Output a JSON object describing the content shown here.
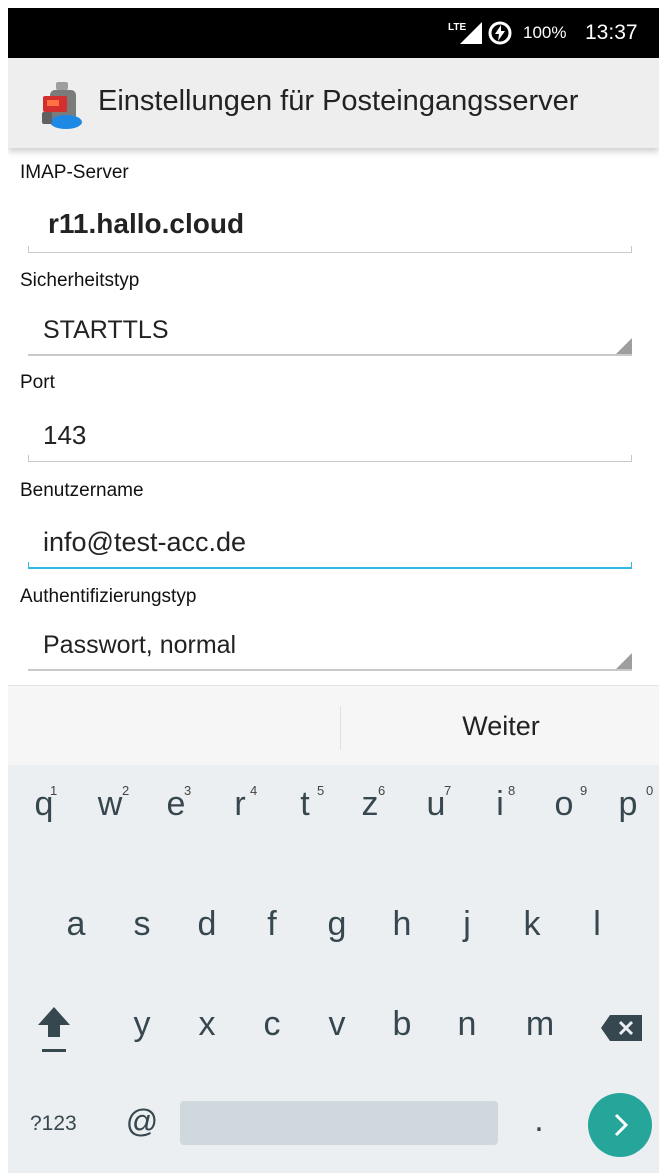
{
  "status_bar": {
    "network": "LTE",
    "battery": "100%",
    "time": "13:37",
    "icons": [
      "lte-signal-icon",
      "data-saver-icon"
    ]
  },
  "app_bar": {
    "title": "Einstellungen für Posteingangsserver",
    "icon": "app-logo-icon"
  },
  "form": {
    "imap_server": {
      "label": "IMAP-Server",
      "value": "r11.hallo.cloud"
    },
    "security": {
      "label": "Sicherheitstyp",
      "value": "STARTTLS"
    },
    "port": {
      "label": "Port",
      "value": "143"
    },
    "username": {
      "label": "Benutzername",
      "value": "info@test-acc.de"
    },
    "auth": {
      "label": "Authentifizierungstyp",
      "value": "Passwort, normal"
    }
  },
  "buttons": {
    "next": "Weiter"
  },
  "keyboard": {
    "row1": [
      "q",
      "w",
      "e",
      "r",
      "t",
      "z",
      "u",
      "i",
      "o",
      "p"
    ],
    "row1_hints": [
      "1",
      "2",
      "3",
      "4",
      "5",
      "6",
      "7",
      "8",
      "9",
      "0"
    ],
    "row2": [
      "a",
      "s",
      "d",
      "f",
      "g",
      "h",
      "j",
      "k",
      "l"
    ],
    "row3": [
      "y",
      "x",
      "c",
      "v",
      "b",
      "n",
      "m"
    ],
    "symbols_key": "?123",
    "at_key": "@",
    "period_key": ".",
    "accent_color": "#26a69a"
  }
}
